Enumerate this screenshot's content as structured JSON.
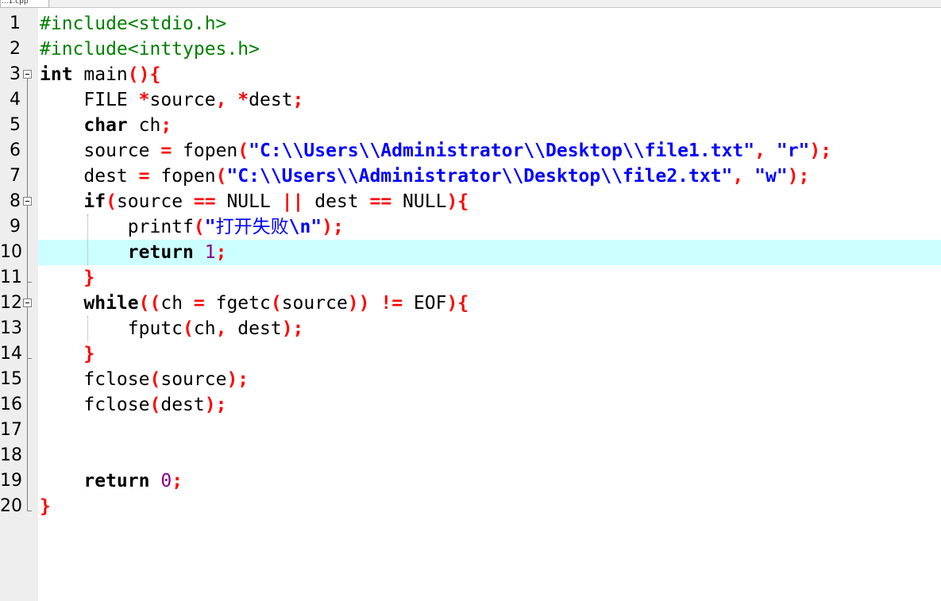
{
  "tab": {
    "label": "...1.cpp"
  },
  "colors": {
    "keyword": "#000000",
    "preprocessor": "#008000",
    "operator": "#ff0000",
    "string": "#0000ff",
    "number": "#880088",
    "current_line": "#ccffff",
    "gutter": "#eeeeee"
  },
  "editor": {
    "current_line": 10,
    "line_numbers": [
      "1",
      "2",
      "3",
      "4",
      "5",
      "6",
      "7",
      "8",
      "9",
      "10",
      "11",
      "12",
      "13",
      "14",
      "15",
      "16",
      "17",
      "18",
      "19",
      "20"
    ],
    "code": {
      "l1": {
        "text": "#include<stdio.h>"
      },
      "l2": {
        "text": "#include<inttypes.h>"
      },
      "l3": {
        "a": "int",
        "b": " main",
        "c": "(){"
      },
      "l4": {
        "a": "    FILE ",
        "b": "*",
        "c": "source",
        "d": ",",
        "e": " ",
        "f": "*",
        "g": "dest",
        "h": ";"
      },
      "l5": {
        "a": "    ",
        "b": "char",
        "c": " ch",
        "d": ";"
      },
      "l6": {
        "a": "    source ",
        "b": "=",
        "c": " fopen",
        "d": "(",
        "e": "\"C:\\\\Users\\\\Administrator\\\\Desktop\\\\file1.txt\"",
        "f": ",",
        "g": " ",
        "h": "\"r\"",
        "i": ");"
      },
      "l7": {
        "a": "    dest ",
        "b": "=",
        "c": " fopen",
        "d": "(",
        "e": "\"C:\\\\Users\\\\Administrator\\\\Desktop\\\\file2.txt\"",
        "f": ",",
        "g": " ",
        "h": "\"w\"",
        "i": ");"
      },
      "l8": {
        "a": "    ",
        "b": "if",
        "c": "(",
        "d": "source ",
        "e": "==",
        "f": " NULL ",
        "g": "||",
        "h": " dest ",
        "i": "==",
        "j": " NULL",
        "k": "){"
      },
      "l9": {
        "a": "        printf",
        "b": "(",
        "c": "\"",
        "d": "打开失败",
        "e": "\\n\"",
        "f": ");"
      },
      "l10": {
        "a": "        ",
        "b": "return",
        "c": " ",
        "d": "1",
        "e": ";"
      },
      "l11": {
        "a": "    ",
        "b": "}"
      },
      "l12": {
        "a": "    ",
        "b": "while",
        "c": "((",
        "d": "ch ",
        "e": "=",
        "f": " fgetc",
        "g": "(",
        "h": "source",
        "i": "))",
        "j": " ",
        "k": "!=",
        "l": " EOF",
        "m": "){"
      },
      "l13": {
        "a": "        fputc",
        "b": "(",
        "c": "ch",
        "d": ",",
        "e": " dest",
        "f": ");"
      },
      "l14": {
        "a": "    ",
        "b": "}"
      },
      "l15": {
        "a": "    fclose",
        "b": "(",
        "c": "source",
        "d": ");"
      },
      "l16": {
        "a": "    fclose",
        "b": "(",
        "c": "dest",
        "d": ");"
      },
      "l19": {
        "a": "    ",
        "b": "return",
        "c": " ",
        "d": "0",
        "e": ";"
      },
      "l20": {
        "a": "}"
      }
    }
  }
}
